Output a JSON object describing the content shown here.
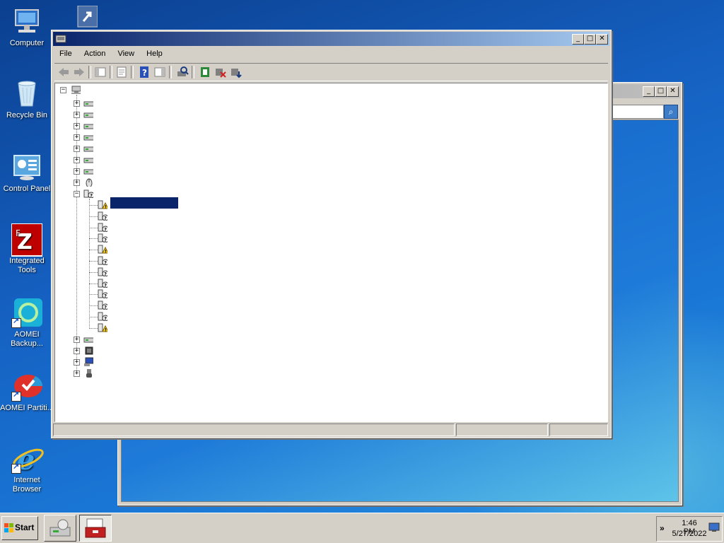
{
  "desktop": {
    "icons": [
      {
        "label": "Computer",
        "icon": "computer-icon"
      },
      {
        "label": "Recycle Bin",
        "icon": "recycle-bin-icon"
      },
      {
        "label": "Control Panel",
        "icon": "control-panel-icon"
      },
      {
        "label": "Integrated Tools",
        "icon": "filezilla-icon"
      },
      {
        "label": "AOMEI Backup...",
        "icon": "aomei-backupper-icon"
      },
      {
        "label": "AOMEI Partiti...",
        "icon": "aomei-partition-icon"
      },
      {
        "label": "Internet Browser",
        "icon": "internet-explorer-icon"
      }
    ]
  },
  "device_manager": {
    "menus": [
      "File",
      "Action",
      "View",
      "Help"
    ],
    "toolbar": [
      "back-icon",
      "forward-icon",
      "show-hide-console-tree-icon",
      "properties-icon",
      "help-icon",
      "show-hide-action-pane-icon",
      "scan-hardware-icon",
      "update-driver-icon",
      "disable-device-icon",
      "uninstall-device-icon"
    ]
  },
  "taskbar": {
    "start_label": "Start",
    "time": "1:46 PM",
    "date": "5/27/2022",
    "tray_chevron": "»"
  }
}
